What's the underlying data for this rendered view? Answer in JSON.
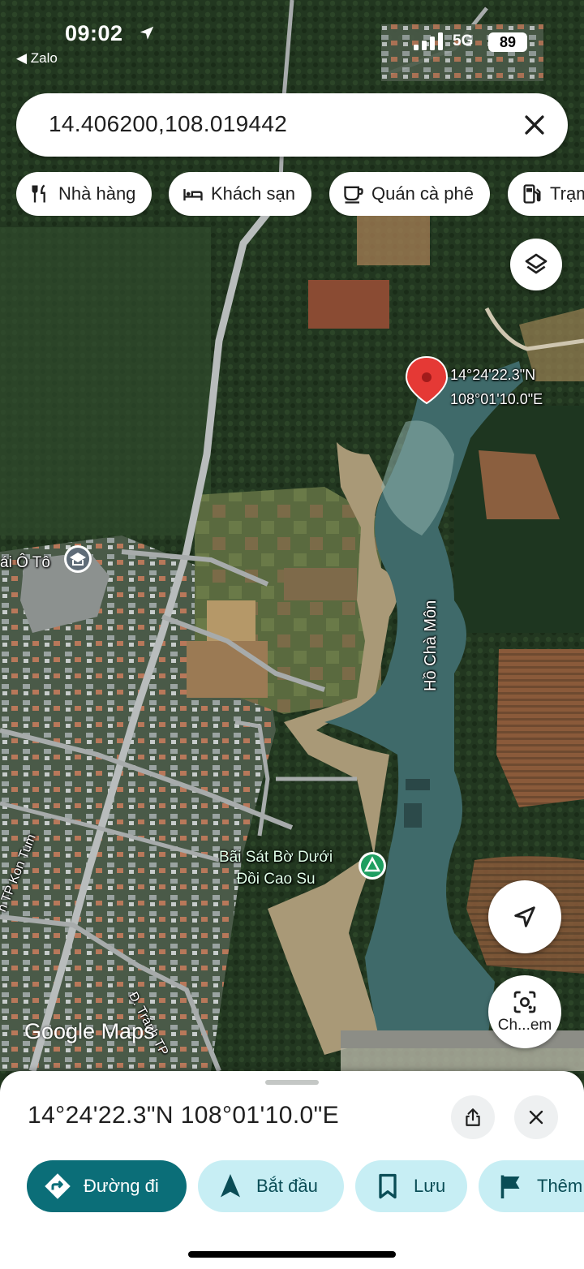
{
  "status_bar": {
    "time": "09:02",
    "back_app": "◀ Zalo",
    "network": "5G",
    "battery": "89"
  },
  "search": {
    "query": "14.406200,108.019442",
    "clear_icon": "close-icon"
  },
  "chips": [
    {
      "label": "Nhà hàng",
      "icon": "restaurant-icon"
    },
    {
      "label": "Khách sạn",
      "icon": "hotel-icon"
    },
    {
      "label": "Quán cà phê",
      "icon": "coffee-icon"
    },
    {
      "label": "Trạm",
      "icon": "gas-station-icon"
    }
  ],
  "map": {
    "pin_coords_line1": "14°24'22.3\"N",
    "pin_coords_line2": "108°01'10.0\"E",
    "lake_name": "Hồ Chà Môn",
    "park_line1": "Bãi Sát Bờ Dưới",
    "park_line2": "Đồi Cao Su",
    "school_label": "ái Ô Tô",
    "road_left": "h TP Kon Tum",
    "road_bottom": "Đ. Tránh TP",
    "logo": "Google Maps",
    "colors": {
      "water": "#3f6a6a",
      "forest": "#1f321c",
      "pin": "#e53935"
    }
  },
  "controls": {
    "layers_icon": "layers-icon",
    "my_location_icon": "navigation-arrow-icon",
    "lens_label": "Ch...em",
    "lens_icon": "camera-search-icon"
  },
  "sheet": {
    "title": "14°24'22.3\"N 108°01'10.0\"E",
    "share_icon": "share-icon",
    "close_icon": "close-icon",
    "buttons": [
      {
        "label": "Đường đi",
        "icon": "directions-icon"
      },
      {
        "label": "Bắt đầu",
        "icon": "navigation-start-icon"
      },
      {
        "label": "Lưu",
        "icon": "bookmark-icon"
      },
      {
        "label": "Thêm",
        "icon": "flag-icon"
      }
    ]
  }
}
